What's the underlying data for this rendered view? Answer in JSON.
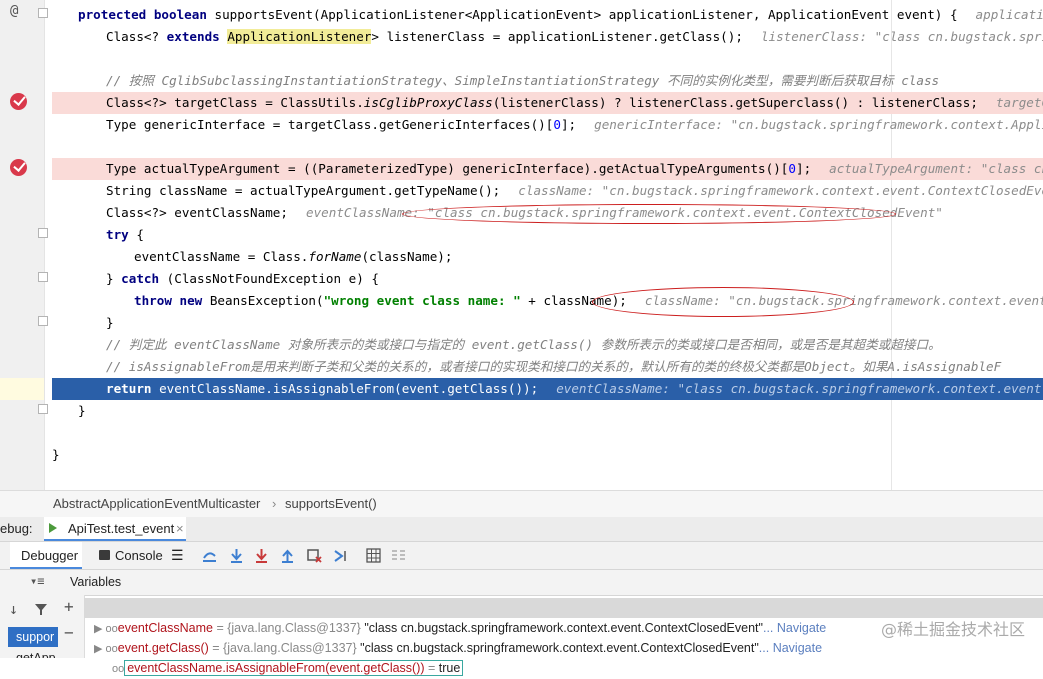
{
  "editor": {
    "lines": {
      "l1": {
        "kw1": "protected boolean",
        "text": " supportsEvent(ApplicationListener<ApplicationEvent> applicationListener, ApplicationEvent event) {",
        "hint": "applicationListener:"
      },
      "l2": {
        "pre": "Class<? ",
        "kw": "extends",
        "hl": "ApplicationListener",
        "post": "> listenerClass = applicationListener.getClass();",
        "hint": "listenerClass: \"class cn.bugstack.springframework"
      },
      "l4": {
        "comment": "// 按照 CglibSubclassingInstantiationStrategy、SimpleInstantiationStrategy 不同的实例化类型，需要判断后获取目标 class"
      },
      "l5": {
        "pre": "Class<?> targetClass = ClassUtils.",
        "it": "isCglibProxyClass",
        "post": "(listenerClass) ? listenerClass.getSuperclass() : listenerClass;",
        "hint": "targetClass: \"cla"
      },
      "l6": {
        "pre": "Type genericInterface = targetClass.getGenericInterfaces()[",
        "num": "0",
        "post": "];",
        "hint": "genericInterface: \"cn.bugstack.springframework.context.ApplicationList"
      },
      "l8": {
        "pre": "Type actualTypeArgument = ((ParameterizedType) genericInterface).getActualTypeArguments()[",
        "num": "0",
        "post": "];",
        "hint": "actualTypeArgument: \"class cn.bugstack."
      },
      "l9": {
        "pre": "String className = actualTypeArgument.getTypeName();",
        "hint": "className: \"cn.bugstack.springframework.context.event.ContextClosedEvent\"  actua"
      },
      "l10": {
        "pre": "Class<?> eventClassName;",
        "hint": "eventClassName: \"class cn.bugstack.springframework.context.event.ContextClosedEvent\""
      },
      "l11": {
        "kw": "try",
        "post": " {"
      },
      "l12": {
        "pre": "eventClassName = Class.",
        "it": "forName",
        "post": "(className);"
      },
      "l13": {
        "pre": "} ",
        "kw": "catch",
        "post": " (ClassNotFoundException e) {"
      },
      "l14": {
        "kw": "throw new",
        "mid": " BeansException(",
        "str": "\"wrong event class name: \"",
        "post": " + className);",
        "hint": "className: \"cn.bugstack.springframework.context.event.ContextCl"
      },
      "l15": {
        "pre": "}"
      },
      "l16": {
        "comment": "// 判定此 eventClassName 对象所表示的类或接口与指定的 event.getClass() 参数所表示的类或接口是否相同，或是否是其超类或超接口。"
      },
      "l17": {
        "comment": "// isAssignableFrom是用来判断子类和父类的关系的，或者接口的实现类和接口的关系的，默认所有的类的终极父类都是Object。如果A.isAssignableF"
      },
      "l18": {
        "kw": "return",
        "post": " eventClassName.isAssignableFrom(event.getClass());",
        "hint": "eventClassName: \"class cn.bugstack.springframework.context.event.ContextClo"
      },
      "l19": {
        "pre": "}"
      },
      "l21": {
        "pre": "}"
      }
    },
    "gutter_icon": "@"
  },
  "breadcrumb": {
    "class": "AbstractApplicationEventMulticaster",
    "sep": "›",
    "method": "supportsEvent()"
  },
  "debug": {
    "prefix": "ebug:",
    "session": "ApiTest.test_event",
    "close": "×",
    "tabs": {
      "debugger": "Debugger",
      "console": "Console"
    },
    "variables_label": "Variables",
    "frame_selected": "suppor",
    "frame_next": "getApp",
    "vars": [
      {
        "name": "eventClassName",
        "type": " = {java.lang.Class@1337} ",
        "value": "\"class cn.bugstack.springframework.context.event.ContextClosedEvent\"",
        "nav": "... Navigate"
      },
      {
        "name": "event.getClass()",
        "type": " = {java.lang.Class@1337} ",
        "value": "\"class cn.bugstack.springframework.context.event.ContextClosedEvent\"",
        "nav": "... Navigate"
      },
      {
        "name": "eventClassName.isAssignableFrom(event.getClass())",
        "type": " = ",
        "value": "true",
        "nav": ""
      }
    ]
  },
  "watermark": "@稀土掘金技术社区",
  "colors": {
    "breakpoint_line": "#fadbd8",
    "current_line": "#2a5fa8",
    "annotation": "#cc1f1f"
  }
}
